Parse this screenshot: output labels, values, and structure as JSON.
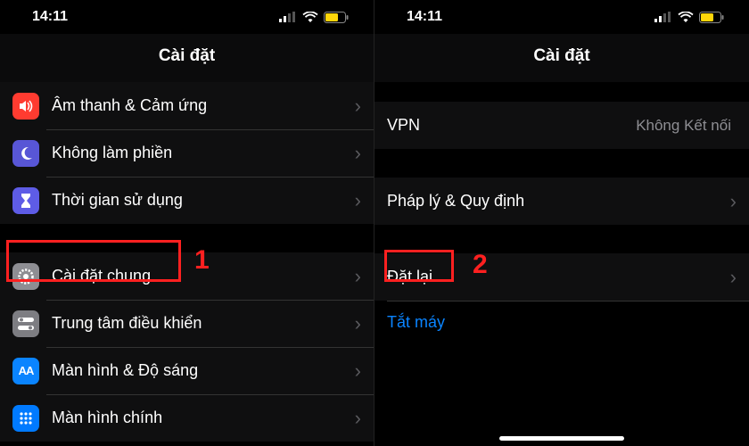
{
  "status": {
    "time": "14:11"
  },
  "left": {
    "title": "Cài đặt",
    "group1": [
      {
        "icon": "sound-icon",
        "label": "Âm thanh & Cảm ứng"
      },
      {
        "icon": "moon-icon",
        "label": "Không làm phiền"
      },
      {
        "icon": "hourglass-icon",
        "label": "Thời gian sử dụng"
      }
    ],
    "group2": [
      {
        "icon": "gear-icon",
        "label": "Cài đặt chung"
      },
      {
        "icon": "switches-icon",
        "label": "Trung tâm điều khiển"
      },
      {
        "icon": "aa-icon",
        "label": "Màn hình & Độ sáng"
      },
      {
        "icon": "grid-icon",
        "label": "Màn hình chính"
      }
    ],
    "callout": "1"
  },
  "right": {
    "title": "Cài đặt",
    "vpn": {
      "label": "VPN",
      "value": "Không Kết nối"
    },
    "legal": {
      "label": "Pháp lý & Quy định"
    },
    "reset": {
      "label": "Đặt lại"
    },
    "shutdown": {
      "label": "Tắt máy"
    },
    "callout": "2"
  }
}
